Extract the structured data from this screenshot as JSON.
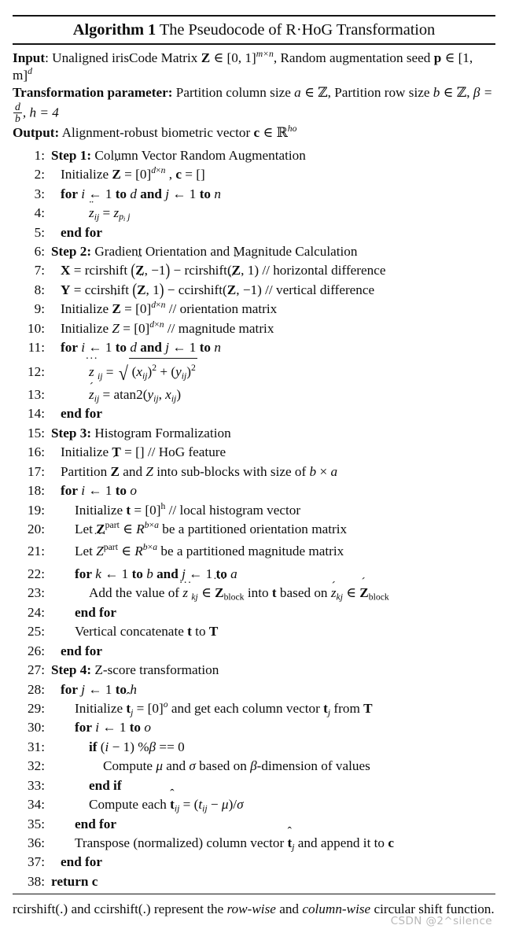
{
  "title": {
    "keyword": "Algorithm 1",
    "rest": "The Pseudocode of R·HoG Transformation"
  },
  "preamble": {
    "input_label": "Input",
    "input_text_1": "Unaligned irisCode Matrix",
    "input_matrix": "Z",
    "input_in": "∈ [0, 1]",
    "input_dims": "m×n",
    "input_text_2": ", Random augmentation seed",
    "input_seed": "p",
    "input_seed_in": "∈ [1, m]",
    "input_seed_dim": "d",
    "param_label": "Transformation parameter:",
    "param_text_1": "Partition column size",
    "param_a": "a",
    "param_a_in": "∈ ℤ",
    "param_text_2": ", Partition row size",
    "param_b": "b",
    "param_b_in": "∈ ℤ",
    "param_beta": "β =",
    "param_frac_num": "d",
    "param_frac_den": "b",
    "param_h": "h = 4",
    "output_label": "Output:",
    "output_text": "Alignment-robust biometric vector",
    "output_c": "c",
    "output_in": "∈ ℝ",
    "output_dims": "ho"
  },
  "lines": [
    {
      "n": "1:",
      "indent": 0,
      "head": "Step 1:",
      "text": "Column Vector Random Augmentation"
    },
    {
      "n": "2:",
      "indent": 1,
      "text": "Initialize Z̈ = [0]^{d×n} , c = []"
    },
    {
      "n": "3:",
      "indent": 1,
      "text": "for i ← 1 to d and j ← 1 to n"
    },
    {
      "n": "4:",
      "indent": 3,
      "text": "z̈_{ij} = z_{p_i j}"
    },
    {
      "n": "5:",
      "indent": 1,
      "text": "end for"
    },
    {
      "n": "6:",
      "indent": 0,
      "head": "Step 2:",
      "text": "Gradient Orientation and Magnitude Calculation"
    },
    {
      "n": "7:",
      "indent": 1,
      "text": "X = rcirshift (Z̈, −1) − rcirshift(Z̈, 1) // horizontal difference"
    },
    {
      "n": "8:",
      "indent": 1,
      "text": "Y = ccirshift (Z̈, 1) − ccirshift(Z̈, −1) // vertical difference"
    },
    {
      "n": "9:",
      "indent": 1,
      "text": "Initialize Ź = [0]^{d×n} // orientation matrix"
    },
    {
      "n": "10:",
      "indent": 1,
      "text": "Initialize Z = [0]^{d×n} // magnitude matrix"
    },
    {
      "n": "11:",
      "indent": 1,
      "text": "for i ← 1 to d and j ← 1 to n"
    },
    {
      "n": "12:",
      "indent": 3,
      "text": "z⃛_{ij} = √((x_{ij})² + (y_{ij})²)"
    },
    {
      "n": "13:",
      "indent": 3,
      "text": "ź_{ij} = atan2(y_{ij}, x_{ij})"
    },
    {
      "n": "14:",
      "indent": 1,
      "text": "end for"
    },
    {
      "n": "15:",
      "indent": 0,
      "head": "Step 3:",
      "text": "Histogram Formalization"
    },
    {
      "n": "16:",
      "indent": 1,
      "text": "Initialize T = [] // HoG feature"
    },
    {
      "n": "17:",
      "indent": 1,
      "text": "Partition Ź and Z into sub-blocks with size of b × a"
    },
    {
      "n": "18:",
      "indent": 1,
      "text": "for i ← 1 to o"
    },
    {
      "n": "19:",
      "indent": 2,
      "text": "Initialize t = [0]^h // local histogram vector"
    },
    {
      "n": "20:",
      "indent": 2,
      "text": "Let Ź^part ∈ R^{b×a} be a partitioned orientation matrix"
    },
    {
      "n": "21:",
      "indent": 2,
      "text": "Let Z⃛^part ∈ R^{b×a} be a partitioned magnitude matrix"
    },
    {
      "n": "22:",
      "indent": 2,
      "text": "for k ← 1 to b and j ← 1 to a"
    },
    {
      "n": "23:",
      "indent": 3,
      "text": "Add the value of z⃛_{kj} ∈ Z⃛_block into t based on ź_{kj} ∈ Ź_block"
    },
    {
      "n": "24:",
      "indent": 2,
      "text": "end for"
    },
    {
      "n": "25:",
      "indent": 2,
      "text": "Vertical concatenate t to T"
    },
    {
      "n": "26:",
      "indent": 1,
      "text": "end for"
    },
    {
      "n": "27:",
      "indent": 0,
      "head": "Step 4:",
      "text": "Z-score transformation"
    },
    {
      "n": "28:",
      "indent": 1,
      "text": "for j ← 1 to h"
    },
    {
      "n": "29:",
      "indent": 2,
      "text": "Initialize t̂_j = [0]^o and get each column vector t_j from T"
    },
    {
      "n": "30:",
      "indent": 2,
      "text": "for i ← 1 to o"
    },
    {
      "n": "31:",
      "indent": 3,
      "text": "if (i − 1) %β == 0"
    },
    {
      "n": "32:",
      "indent": 4,
      "text": "Compute μ and σ based on β-dimension of values"
    },
    {
      "n": "33:",
      "indent": 3,
      "text": "end if"
    },
    {
      "n": "34:",
      "indent": 3,
      "text": "Compute each t̂_{ij} = (t_{ij} − μ)/σ"
    },
    {
      "n": "35:",
      "indent": 2,
      "text": "end for"
    },
    {
      "n": "36:",
      "indent": 2,
      "text": "Transpose (normalized) column vector t̂_j and append it to c"
    },
    {
      "n": "37:",
      "indent": 1,
      "text": "end for"
    },
    {
      "n": "38:",
      "indent": 0,
      "text": "return c"
    }
  ],
  "footnote": {
    "text_1": "rcirshift(.) and ccirshift(.) represent the",
    "em_1": "row-wise",
    "text_2": "and",
    "em_2": "column-wise",
    "text_3": "circular shift function."
  },
  "watermark": "CSDN @2^silence",
  "colors": {
    "text": "#0d0d0d",
    "rule": "#141414",
    "watermark": "#b8b8b8",
    "background": "#ffffff"
  }
}
